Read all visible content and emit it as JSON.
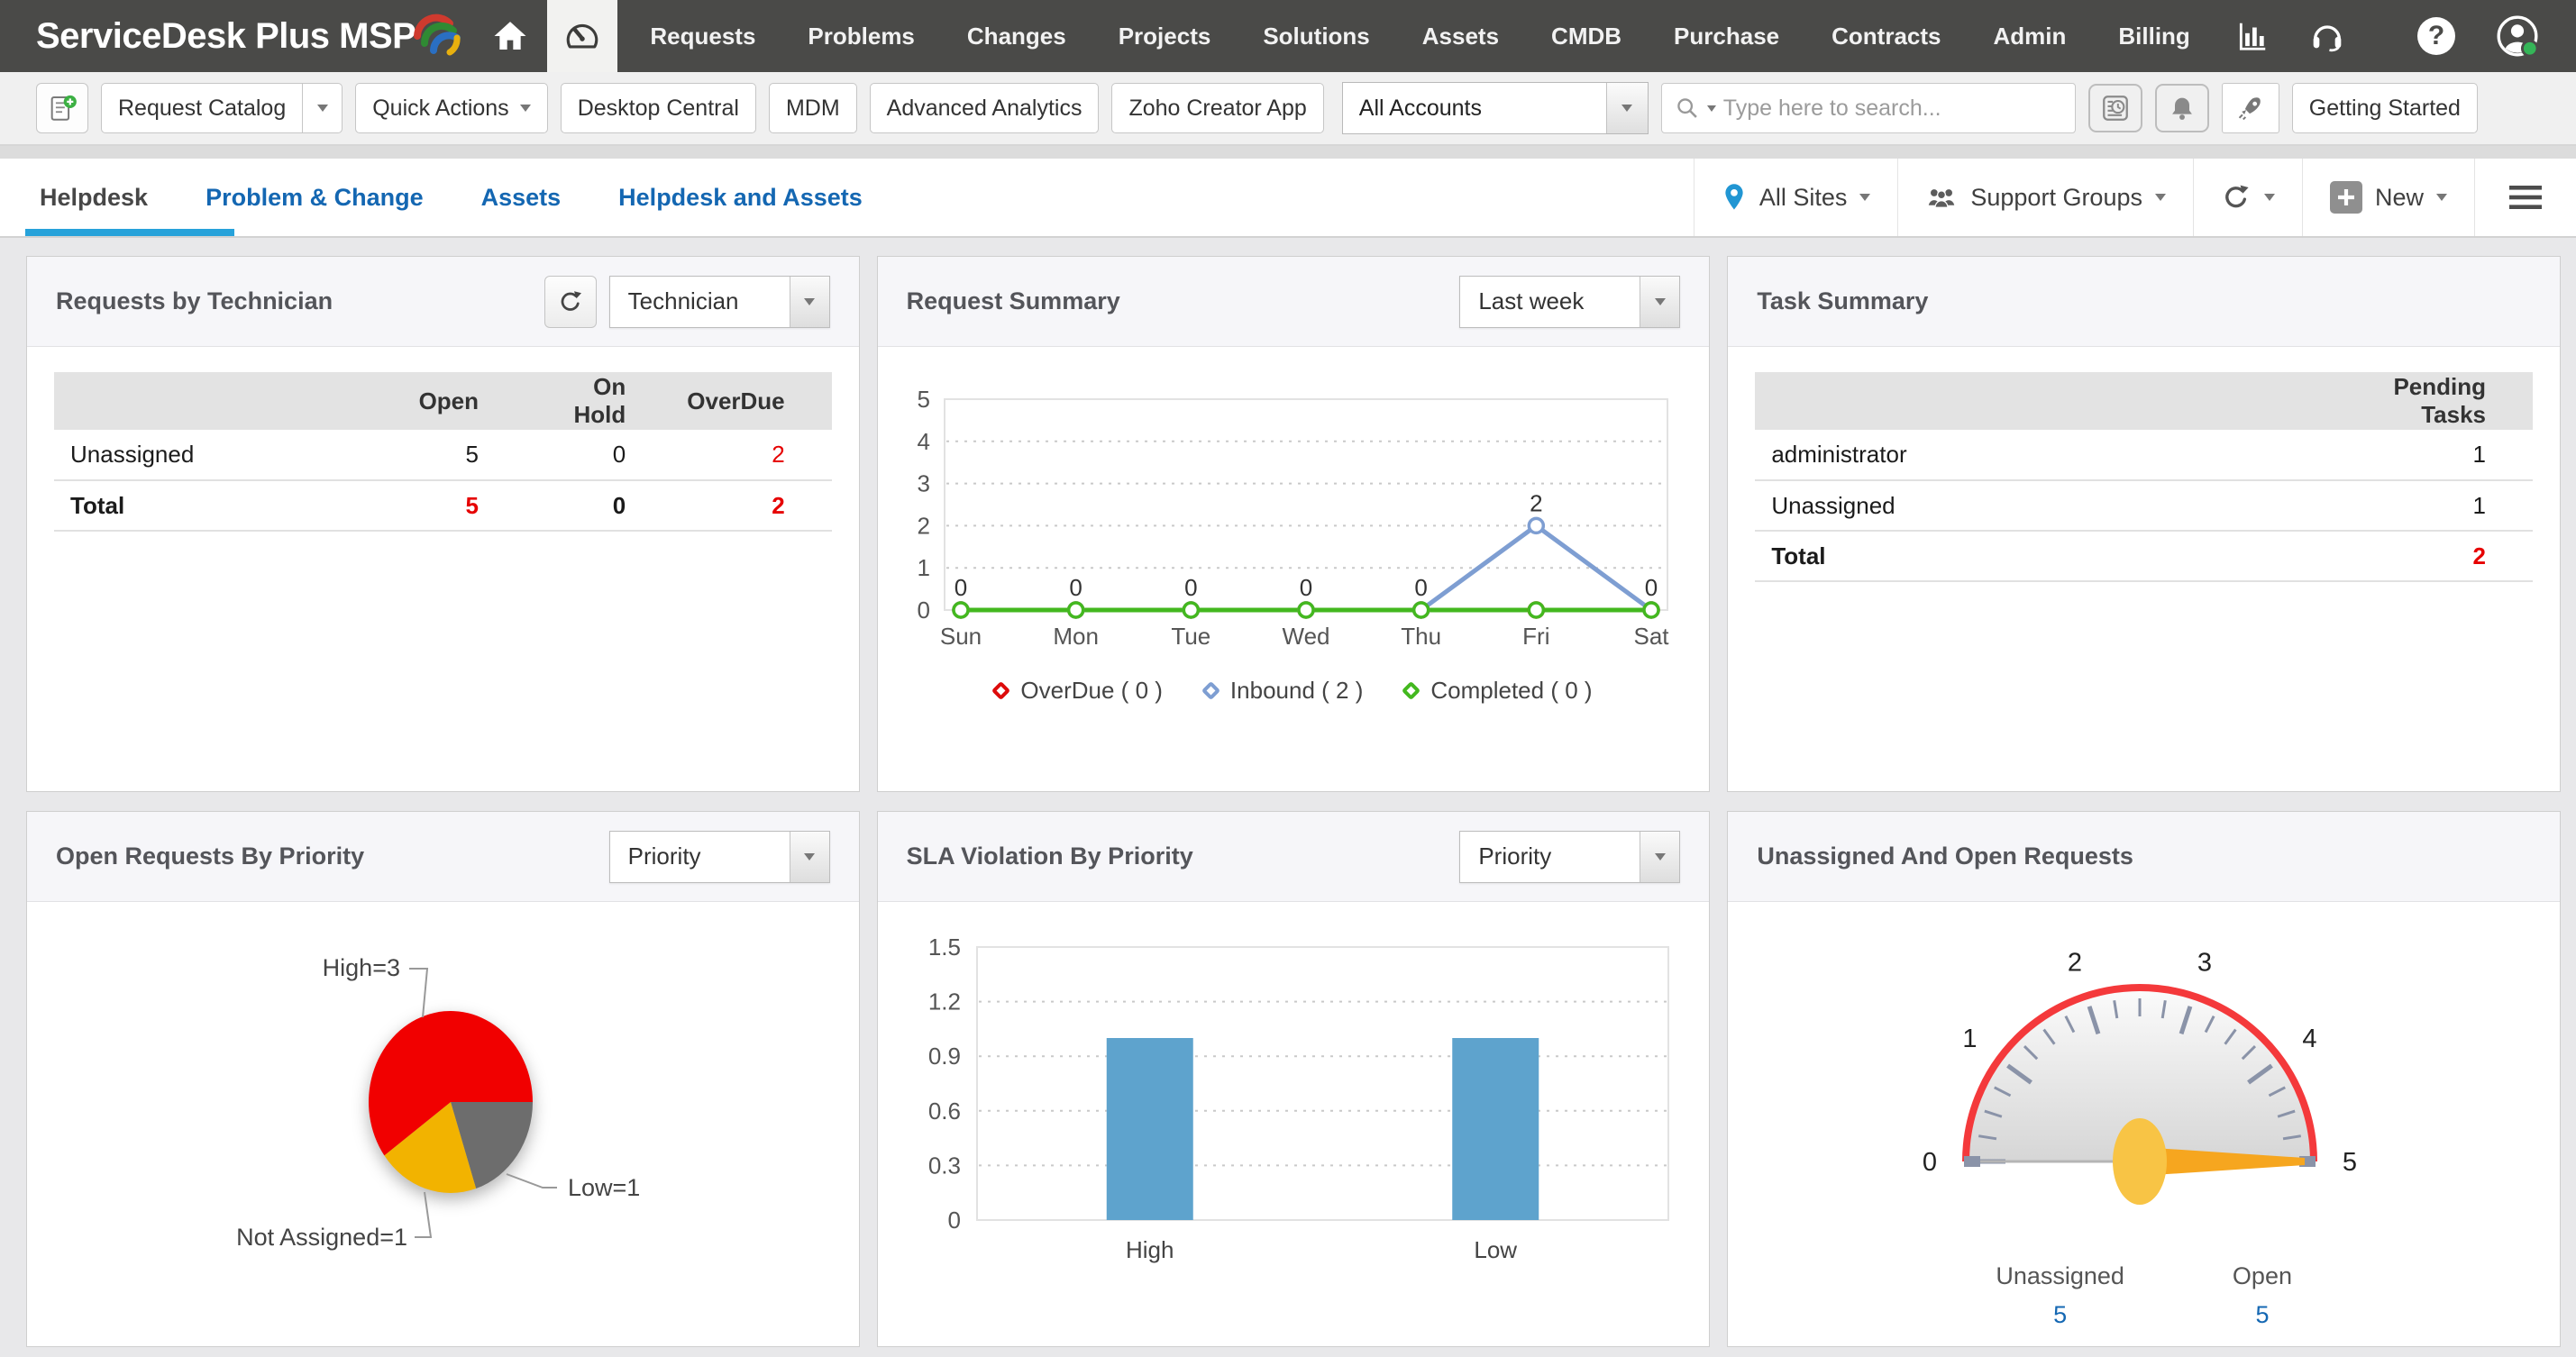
{
  "topnav": {
    "logo_text": "ServiceDesk Plus MSP",
    "help_glyph": "?",
    "items": [
      "Requests",
      "Problems",
      "Changes",
      "Projects",
      "Solutions",
      "Assets",
      "CMDB",
      "Purchase",
      "Contracts",
      "Admin",
      "Billing"
    ]
  },
  "toolbar": {
    "request_catalog_label": "Request Catalog",
    "quick_actions_label": "Quick Actions",
    "buttons": [
      "Desktop Central",
      "MDM",
      "Advanced Analytics",
      "Zoho Creator App"
    ],
    "account_selected": "All Accounts",
    "search_placeholder": "Type here to search...",
    "getting_started_label": "Getting Started"
  },
  "tabbar": {
    "tabs": [
      {
        "label": "Helpdesk",
        "active": true
      },
      {
        "label": "Problem & Change",
        "active": false
      },
      {
        "label": "Assets",
        "active": false
      },
      {
        "label": "Helpdesk and Assets",
        "active": false
      }
    ],
    "sites_label": "All Sites",
    "groups_label": "Support Groups",
    "new_label": "New"
  },
  "panels": {
    "requests_by_technician": {
      "title": "Requests by Technician",
      "filter": "Technician",
      "columns": [
        "",
        "Open",
        "On Hold",
        "OverDue"
      ],
      "rows": [
        {
          "label": "Unassigned",
          "bold": false,
          "cells": [
            {
              "v": "5"
            },
            {
              "v": "0"
            },
            {
              "v": "2",
              "red": true
            }
          ]
        },
        {
          "label": "Total",
          "bold": true,
          "cells": [
            {
              "v": "5",
              "red": true
            },
            {
              "v": "0"
            },
            {
              "v": "2",
              "red": true
            }
          ]
        }
      ]
    },
    "request_summary": {
      "title": "Request Summary",
      "filter": "Last week"
    },
    "task_summary": {
      "title": "Task Summary",
      "columns": [
        "",
        "Pending Tasks"
      ],
      "rows": [
        {
          "label": "administrator",
          "bold": false,
          "cells": [
            {
              "v": "1"
            }
          ]
        },
        {
          "label": "Unassigned",
          "bold": false,
          "cells": [
            {
              "v": "1"
            }
          ]
        },
        {
          "label": "Total",
          "bold": true,
          "cells": [
            {
              "v": "2",
              "red": true
            }
          ]
        }
      ]
    },
    "open_requests_by_priority": {
      "title": "Open Requests By Priority",
      "filter": "Priority"
    },
    "sla_violation_by_priority": {
      "title": "SLA Violation By Priority",
      "filter": "Priority"
    },
    "unassigned_and_open": {
      "title": "Unassigned And Open Requests"
    }
  },
  "chart_data": [
    {
      "id": "request_summary",
      "type": "line",
      "x": [
        "Sun",
        "Mon",
        "Tue",
        "Wed",
        "Thu",
        "Fri",
        "Sat"
      ],
      "series": [
        {
          "name": "OverDue",
          "total": 0,
          "color": "#dd0b0b",
          "values": [
            0,
            0,
            0,
            0,
            0,
            0,
            0
          ]
        },
        {
          "name": "Inbound",
          "total": 2,
          "color": "#7e9ed2",
          "values": [
            0,
            0,
            0,
            0,
            0,
            2,
            0
          ]
        },
        {
          "name": "Completed",
          "total": 0,
          "color": "#43b81f",
          "values": [
            0,
            0,
            0,
            0,
            0,
            0,
            0
          ]
        }
      ],
      "ylim": [
        0,
        5
      ],
      "yticks": [
        0,
        1,
        2,
        3,
        4,
        5
      ],
      "grid": true,
      "legend": "bottom"
    },
    {
      "id": "open_requests_by_priority",
      "type": "pie",
      "slices": [
        {
          "label": "Low",
          "value": 1,
          "color": "#6d6d6d",
          "callout": "Low=1"
        },
        {
          "label": "Not Assigned",
          "value": 1,
          "color": "#f2b300",
          "callout": "Not Assigned=1"
        },
        {
          "label": "High",
          "value": 3,
          "color": "#f10000",
          "callout": "High=3"
        }
      ],
      "start_angle_deg": 0,
      "clockwise": true
    },
    {
      "id": "sla_violation_by_priority",
      "type": "bar",
      "categories": [
        "High",
        "Low"
      ],
      "values": [
        1,
        1
      ],
      "bar_color": "#5ea3cd",
      "ylim": [
        0,
        1.5
      ],
      "yticks": [
        0,
        0.3,
        0.6,
        0.9,
        1.2,
        1.5
      ],
      "grid": true
    },
    {
      "id": "unassigned_and_open",
      "type": "gauge",
      "min": 0,
      "max": 5,
      "value": 5,
      "tick_labels": [
        0,
        1,
        2,
        3,
        4,
        5
      ],
      "arc_color": "#f4393b",
      "needle_color": "#f6a61f",
      "stats": [
        {
          "label": "Unassigned",
          "value": "5"
        },
        {
          "label": "Open",
          "value": "5"
        }
      ]
    }
  ],
  "colors": {
    "nav_bg": "#4a4a48",
    "accent_blue": "#1568b3",
    "tab_underline": "#27a2da",
    "red": "#e60000",
    "bar": "#5ea3cd",
    "pie_high": "#f10000",
    "pie_low": "#6d6d6d",
    "pie_not_assigned": "#f2b300",
    "line_green": "#43b81f",
    "line_blue": "#7e9ed2",
    "line_red": "#dd0b0b",
    "gauge_arc": "#f4393b",
    "gauge_needle": "#f6a61f",
    "pin_blue": "#2196d3",
    "presence_green": "#35b558"
  }
}
